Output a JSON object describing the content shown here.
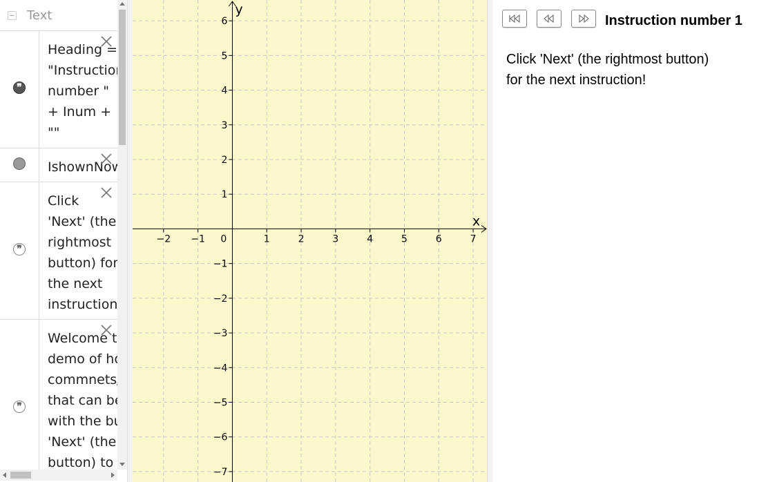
{
  "algebra": {
    "group_title": "Text",
    "collapse_symbol": "−",
    "items": [
      {
        "id": "heading",
        "marble": "dark",
        "text": "Heading =\n\"Instruction\nnumber \"\n+ Inum +\n\"\""
      },
      {
        "id": "ishownnow",
        "marble": "grey",
        "text": "IshownNow"
      },
      {
        "id": "click-next",
        "marble": "light",
        "text": "Click\n'Next' (the\nrightmost\nbutton) for\nthe next\ninstruction!"
      },
      {
        "id": "welcome",
        "marble": "light",
        "text": "Welcome to\ndemo of ho\ncommnets/\nthat can be\nwith the bu\n'Next' (the\nbutton) to"
      }
    ]
  },
  "graphics": {
    "background": "#fdf8cc",
    "grid_color": "#c8c8c8",
    "axis_color": "#000000",
    "x_axis_label": "x",
    "y_axis_label": "y",
    "origin_label": "0",
    "x_tick_labels": [
      "−2",
      "−1",
      "1",
      "2",
      "3",
      "4",
      "5",
      "6",
      "7"
    ],
    "y_tick_labels": [
      "6",
      "5",
      "4",
      "3",
      "2",
      "1",
      "−1",
      "−2",
      "−3",
      "−4",
      "−5",
      "−6",
      "−7"
    ],
    "x_ticks": [
      -2,
      -1,
      1,
      2,
      3,
      4,
      5,
      6,
      7
    ],
    "y_ticks": [
      6,
      5,
      4,
      3,
      2,
      1,
      -1,
      -2,
      -3,
      -4,
      -5,
      -6,
      -7
    ],
    "x_range": [
      -2.9,
      7.4
    ],
    "y_range": [
      -7.3,
      6.6
    ]
  },
  "graphics2": {
    "buttons": [
      {
        "id": "first",
        "icon": "skip-to-first-icon"
      },
      {
        "id": "previous",
        "icon": "previous-icon"
      },
      {
        "id": "next",
        "icon": "next-icon"
      }
    ],
    "heading": "Instruction number 1",
    "body_lines": [
      "Click 'Next' (the rightmost button)",
      "for the next instruction!"
    ]
  }
}
